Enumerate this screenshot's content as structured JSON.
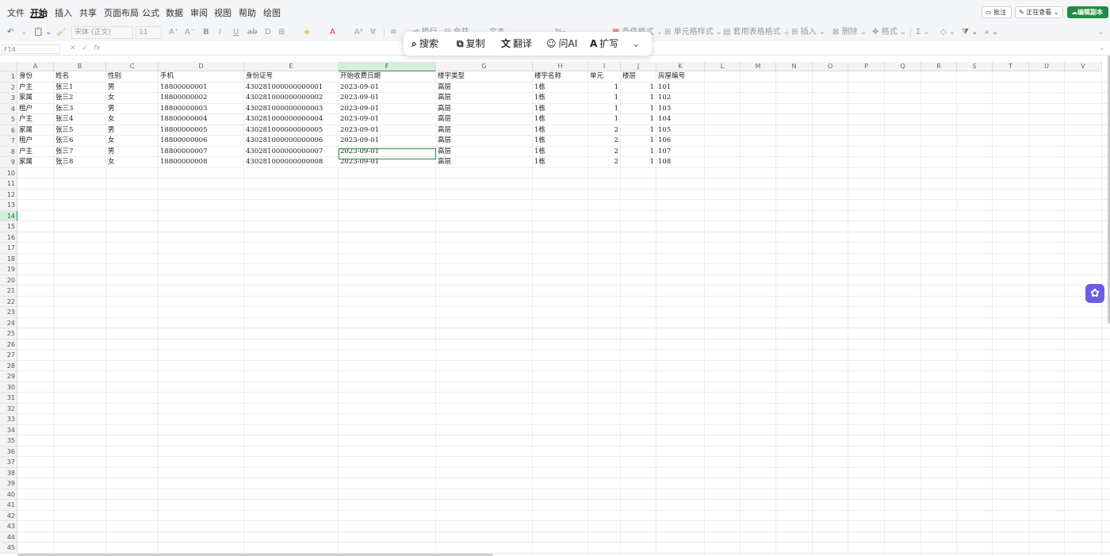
{
  "menu": {
    "items": [
      "文件",
      "开始",
      "插入",
      "共享",
      "页面布局",
      "公式",
      "数据",
      "审阅",
      "视图",
      "帮助",
      "绘图"
    ],
    "active_index": 1
  },
  "top_right": {
    "comment": "批注",
    "viewing": "正在查看",
    "edit_copy": "编辑副本"
  },
  "toolbar": {
    "font_name": "宋体 (正文)",
    "font_size": "11",
    "wrap": "换行",
    "merge": "合并",
    "format": "文本",
    "cond_format": "条件格式",
    "cell_style": "单元格样式",
    "table_style": "套用表格格式",
    "insert": "插入",
    "delete": "删除",
    "format_btn": "格式"
  },
  "floating_bar": {
    "search": "搜索",
    "copy": "复制",
    "translate": "翻译",
    "ask_ai": "问AI",
    "expand": "扩写"
  },
  "formula_bar": {
    "name_box": "F14",
    "fx": "fx",
    "content": ""
  },
  "sheet": {
    "columns": [
      "A",
      "B",
      "C",
      "D",
      "E",
      "F",
      "G",
      "H",
      "I",
      "J",
      "K",
      "L",
      "M",
      "N",
      "O",
      "P",
      "Q",
      "R",
      "S",
      "T",
      "U",
      "V"
    ],
    "selected_column": "F",
    "selected_row": 14,
    "row_count": 45,
    "header_row": [
      "身份",
      "姓名",
      "性别",
      "手机",
      "身份证号",
      "开始收费日期",
      "楼宇类型",
      "楼宇名称",
      "单元",
      "楼层",
      "房屋编号"
    ],
    "rows": [
      [
        "户主",
        "张三1",
        "男",
        "18800000001",
        "430281000000000001",
        "2023-09-01",
        "高层",
        "1栋",
        "1",
        "1",
        "101"
      ],
      [
        "家属",
        "张三2",
        "女",
        "18800000002",
        "430281000000000002",
        "2023-09-01",
        "高层",
        "1栋",
        "1",
        "1",
        "102"
      ],
      [
        "租户",
        "张三3",
        "男",
        "18800000003",
        "430281000000000003",
        "2023-09-01",
        "高层",
        "1栋",
        "1",
        "1",
        "103"
      ],
      [
        "户主",
        "张三4",
        "女",
        "18800000004",
        "430281000000000004",
        "2023-09-01",
        "高层",
        "1栋",
        "1",
        "1",
        "104"
      ],
      [
        "家属",
        "张三5",
        "男",
        "18800000005",
        "430281000000000005",
        "2023-09-01",
        "高层",
        "1栋",
        "2",
        "1",
        "105"
      ],
      [
        "租户",
        "张三6",
        "女",
        "18800000006",
        "430281000000000006",
        "2023-09-01",
        "高层",
        "1栋",
        "2",
        "1",
        "106"
      ],
      [
        "户主",
        "张三7",
        "男",
        "18800000007",
        "430281000000000007",
        "2023-09-01",
        "高层",
        "1栋",
        "2",
        "1",
        "107"
      ],
      [
        "家属",
        "张三8",
        "女",
        "18800000008",
        "430281000000000008",
        "2023-09-01",
        "高层",
        "1栋",
        "2",
        "1",
        "108"
      ]
    ]
  }
}
